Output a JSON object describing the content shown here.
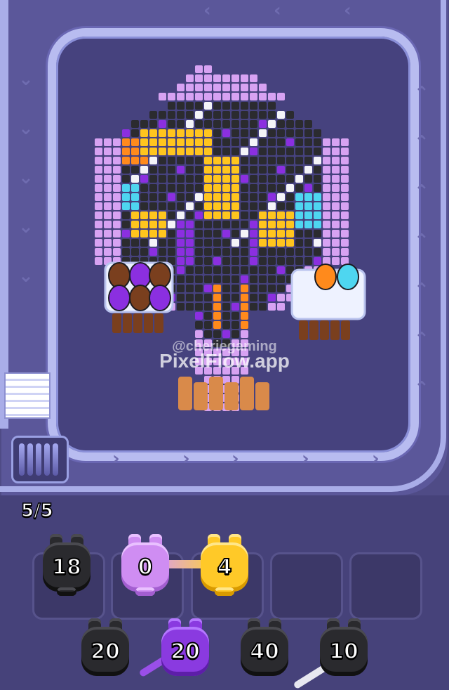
{
  "game": {
    "watermark_line1": "@cheriegaming",
    "watermark_line2": "PixelFlow.app",
    "slots_counter": "5/5"
  },
  "queue": [
    {
      "color": "black",
      "value": "18"
    },
    {
      "color": "violet",
      "value": "0"
    },
    {
      "color": "gold",
      "value": "4"
    },
    {
      "color": "empty",
      "value": ""
    },
    {
      "color": "empty",
      "value": ""
    }
  ],
  "shooters": [
    {
      "color": "black",
      "value": "20"
    },
    {
      "color": "purple",
      "value": "20"
    },
    {
      "color": "black",
      "value": "40"
    },
    {
      "color": "black",
      "value": "10"
    }
  ],
  "palette": {
    "lavender": "#d7a2f2",
    "black": "#2b2b2f",
    "gold": "#ffc51e",
    "orange": "#ff8a1c",
    "purple": "#8b2fe0",
    "white": "#f4f4f8",
    "cyan": "#4ed6f0",
    "brown": "#7a3f1e"
  },
  "icons": [
    "pixel-art-phoenix",
    "pig-shooter-icon",
    "conveyor-chevron-icon"
  ]
}
